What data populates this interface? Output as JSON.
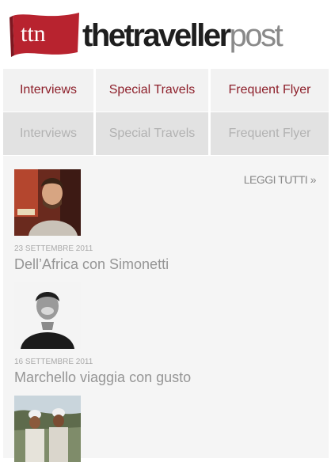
{
  "brand": {
    "badge_text": "ttn",
    "name_part1": "thetraveller",
    "name_part2": "post",
    "color_flag": "#b8232f"
  },
  "nav_primary": [
    "Interviews",
    "Special Travels",
    "Frequent Flyer"
  ],
  "nav_secondary": [
    "Interviews",
    "Special Travels",
    "Frequent Flyer"
  ],
  "section": {
    "read_all": "LEGGI TUTTI »"
  },
  "articles": [
    {
      "date": "23 SETTEMBRE 2011",
      "title": "Dell’Africa con Simonetti"
    },
    {
      "date": "16 SETTEMBRE 2011",
      "title": "Marchello viaggia con gusto"
    },
    {
      "date": "",
      "title": ""
    }
  ]
}
